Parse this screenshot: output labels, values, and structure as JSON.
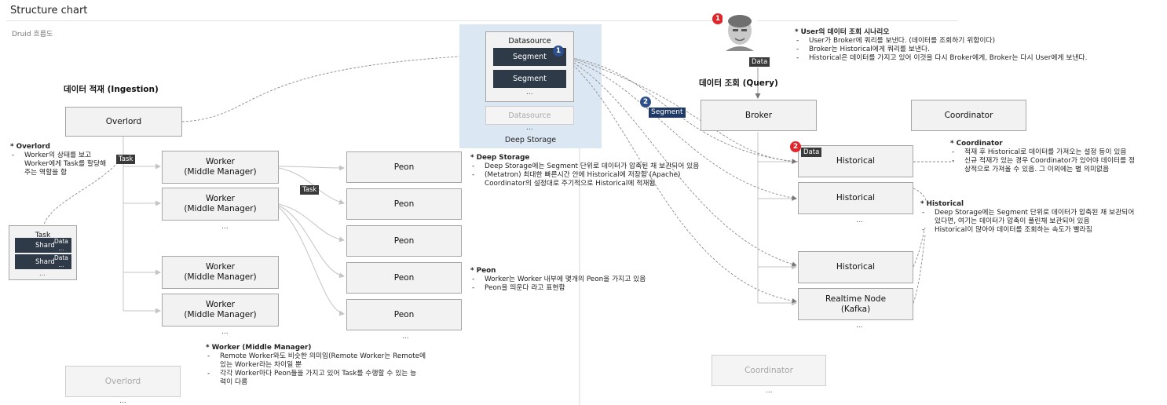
{
  "header": {
    "title": "Structure chart",
    "subtitle": "Druid 흐름도"
  },
  "sections": {
    "ingestion": "데이터 적재 (Ingestion)",
    "query": "데이터 조회 (Query)"
  },
  "ingestion": {
    "overlord": "Overlord",
    "overlord_faded": "Overlord",
    "overlord_faded_more": "...",
    "task_tag": "Task",
    "task_tag2": "Task",
    "workers": [
      "Worker\n(Middle Manager)",
      "Worker\n(Middle Manager)",
      "Worker\n(Middle Manager)",
      "Worker\n(Middle Manager)"
    ],
    "workers_more": "...",
    "workers_more_bottom": "...",
    "peons": [
      "Peon",
      "Peon",
      "Peon",
      "Peon",
      "Peon"
    ],
    "peons_more": "...",
    "task_card": {
      "title": "Task",
      "shards": [
        {
          "label": "Shard",
          "data": "Data",
          "more": "..."
        },
        {
          "label": "Shard",
          "data": "Data",
          "more": "..."
        }
      ],
      "more": "..."
    }
  },
  "deep_storage": {
    "datasource_title": "Datasource",
    "segments": [
      "Segment",
      "Segment"
    ],
    "segments_more": "...",
    "datasource_faded": "Datasource",
    "datasource_faded_more": "...",
    "label": "Deep Storage",
    "badge": "1"
  },
  "query": {
    "user_badge": "1",
    "data_tag": "Data",
    "broker": "Broker",
    "coordinator": "Coordinator",
    "coordinator_faded": "Coordinator",
    "coordinator_faded_more": "...",
    "historicals": [
      "Historical",
      "Historical",
      "Historical"
    ],
    "historicals_more": "...",
    "realtime": "Realtime Node\n(Kafka)",
    "realtime_more": "...",
    "historical_badge": "2",
    "historical_data_tag": "Data",
    "segment_badge": "2",
    "segment_tag": "Segment"
  },
  "notes": {
    "overlord": {
      "heading": "* Overlord",
      "items": [
        "Worker의 상태를 보고\nWorker에게 Task를 할당해\n주는 역할을 함"
      ]
    },
    "deep_storage": {
      "heading": "* Deep Storage",
      "items": [
        "Deep Storage에는 Segment 단위로 데이터가 압축된 채 보관되어 있음",
        "(Metatron) 최대한 빠른시간 안에 Historical에 저장함 (Apache)\nCoordinator의 설정대로 주기적으로 Historical에 적재됨"
      ]
    },
    "peon": {
      "heading": "* Peon",
      "items": [
        "Worker는 Worker 내부에 몇개의 Peon을 가지고 있음",
        "Peon을 띄운다 라고 표현함"
      ]
    },
    "worker": {
      "heading": "* Worker (Middle Manager)",
      "items": [
        "Remote Worker와도 비슷한 의미임(Remote Worker는 Remote에\n있는 Worker라는 차이일 뿐",
        "각각 Worker마다 Peon들을 가지고 있어 Task를 수행할 수 있는 능\n력이 다름"
      ]
    },
    "user_scenario": {
      "heading": "* User의 데이터 조회 시나리오",
      "items": [
        "User가 Broker에 쿼리를 보낸다. (데이터를 조회하기 위함이다)",
        "Broker는 Historical에게 쿼리를 보낸다.",
        "Historical은 데이터를 가지고 있어 이것을 다시 Broker에게, Broker는 다시 User에게 보낸다."
      ]
    },
    "coordinator": {
      "heading": "* Coordinator",
      "items": [
        "적재 후 Historical로 데이터를 가져오는 설정 등이 있음",
        "신규 적재가 있는 경우 Coordinator가 있어야 데이터를 정\n상적으로 가져올 수 있음. 그 이외에는 별 의미없음"
      ]
    },
    "historical": {
      "heading": "* Historical",
      "items": [
        "Deep Storage에는 Segment 단위로 데이터가 압축된 채 보관되어\n있다면, 여기는 데이터가 압축이 풀린채 보관되어 있음",
        "Historical이 많아야 데이터를 조회하는 속도가 빨라짐"
      ]
    }
  }
}
